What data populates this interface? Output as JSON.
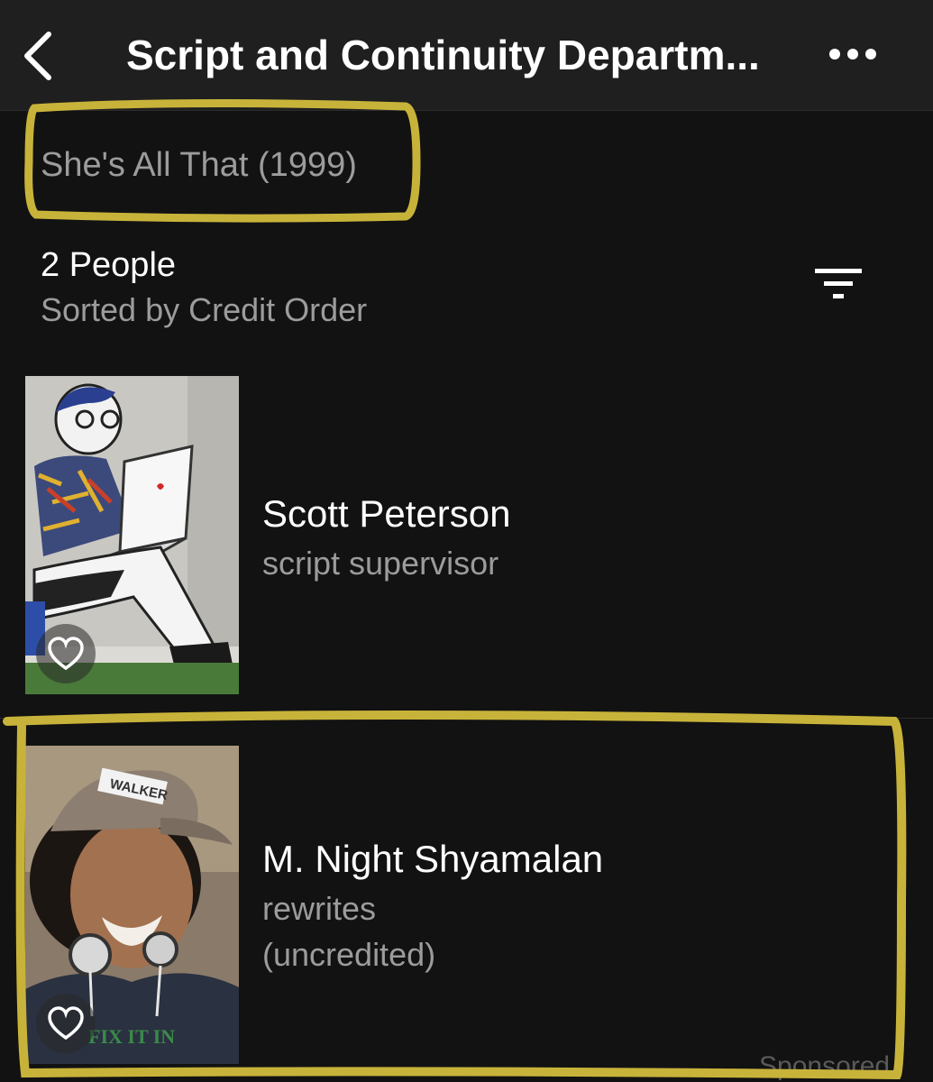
{
  "navbar": {
    "title": "Script and Continuity Departm...",
    "back_icon": "chevron-left-icon",
    "more_icon": "more-horizontal-icon"
  },
  "movie": {
    "title": "She's All That (1999)"
  },
  "list_header": {
    "count_text": "2 People",
    "sort_text": "Sorted by Credit Order",
    "filter_icon": "filter-icon"
  },
  "people": [
    {
      "name": "Scott Peterson",
      "role": "script supervisor",
      "photo_icon": "mural-illustration-image",
      "favorite_icon": "heart-outline-icon"
    },
    {
      "name": "M. Night Shyamalan",
      "role": "rewrites",
      "note": "(uncredited)",
      "photo_icon": "person-photo-image",
      "photo_cap_text": "WALKER",
      "photo_shirt_text": "FIX IT IN",
      "favorite_icon": "heart-outline-icon"
    }
  ],
  "footer": {
    "sponsored_label": "Sponsored"
  },
  "colors": {
    "background": "#121212",
    "navbar": "#1f1f1f",
    "primary_text": "#ffffff",
    "secondary_text": "#9c9c9c",
    "highlight_marker": "#c8b33a"
  }
}
